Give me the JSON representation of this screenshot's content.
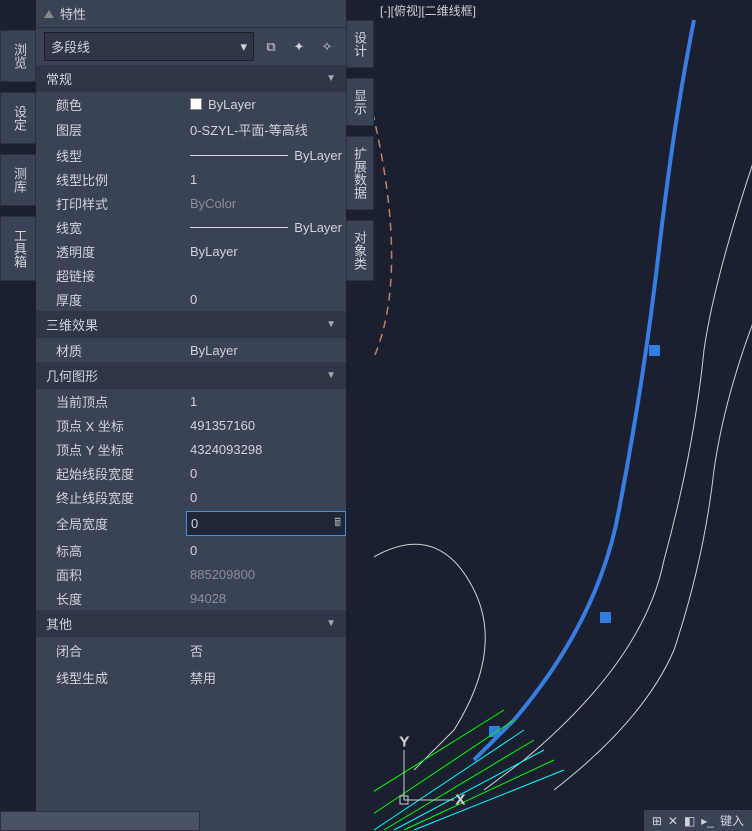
{
  "panel_title": "特性",
  "object_type": "多段线",
  "view_label": "[-][俯视][二维线框]",
  "left_tabs": [
    "浏览",
    "设定",
    "测库",
    "工具箱"
  ],
  "right_tabs": [
    "设计",
    "显示",
    "扩展数据",
    "对象类"
  ],
  "sections": {
    "general": {
      "title": "常规"
    },
    "threed": {
      "title": "三维效果"
    },
    "geometry": {
      "title": "几何图形"
    },
    "other": {
      "title": "其他"
    }
  },
  "props": {
    "color": {
      "label": "颜色",
      "value": "ByLayer"
    },
    "layer": {
      "label": "图层",
      "value": "0-SZYL-平面-等高线"
    },
    "linetype": {
      "label": "线型",
      "value": "ByLayer"
    },
    "ltscale": {
      "label": "线型比例",
      "value": "1"
    },
    "plotstyle": {
      "label": "打印样式",
      "value": "ByColor"
    },
    "lineweight": {
      "label": "线宽",
      "value": "ByLayer"
    },
    "transparency": {
      "label": "透明度",
      "value": "ByLayer"
    },
    "hyperlink": {
      "label": "超链接",
      "value": ""
    },
    "thickness": {
      "label": "厚度",
      "value": "0"
    },
    "material": {
      "label": "材质",
      "value": "ByLayer"
    },
    "current_vertex": {
      "label": "当前顶点",
      "value": "1"
    },
    "vertex_x": {
      "label": "顶点 X 坐标",
      "value": "491357160"
    },
    "vertex_y": {
      "label": "顶点 Y 坐标",
      "value": "4324093298"
    },
    "start_width": {
      "label": "起始线段宽度",
      "value": "0"
    },
    "end_width": {
      "label": "终止线段宽度",
      "value": "0"
    },
    "global_width": {
      "label": "全局宽度",
      "value": "0"
    },
    "elevation": {
      "label": "标高",
      "value": "0"
    },
    "area": {
      "label": "面积",
      "value": "885209800"
    },
    "length": {
      "label": "长度",
      "value": "94028"
    },
    "closed": {
      "label": "闭合",
      "value": "否"
    },
    "ltgen": {
      "label": "线型生成",
      "value": "禁用"
    }
  },
  "status": {
    "cmd_placeholder": "键入"
  }
}
